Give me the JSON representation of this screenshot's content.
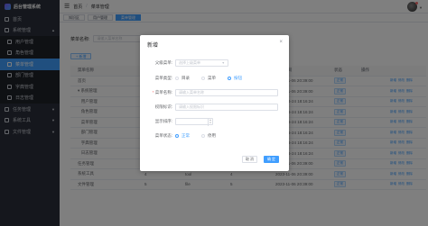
{
  "app": {
    "brand": "后台管理系统"
  },
  "sidebar": {
    "items": [
      {
        "label": "首页",
        "active": false,
        "sub": false,
        "caret": ""
      },
      {
        "label": "系统管理",
        "active": false,
        "sub": false,
        "caret": "▲"
      },
      {
        "label": "用户管理",
        "active": false,
        "sub": true,
        "caret": ""
      },
      {
        "label": "角色管理",
        "active": false,
        "sub": true,
        "caret": ""
      },
      {
        "label": "菜单管理",
        "active": true,
        "sub": true,
        "caret": ""
      },
      {
        "label": "部门管理",
        "active": false,
        "sub": true,
        "caret": ""
      },
      {
        "label": "字典管理",
        "active": false,
        "sub": true,
        "caret": ""
      },
      {
        "label": "日志管理",
        "active": false,
        "sub": true,
        "caret": ""
      },
      {
        "label": "任务管理",
        "active": false,
        "sub": false,
        "caret": "▼"
      },
      {
        "label": "系统工具",
        "active": false,
        "sub": false,
        "caret": "▼"
      },
      {
        "label": "文件管理",
        "active": false,
        "sub": false,
        "caret": "▼"
      }
    ]
  },
  "header": {
    "crumb1": "首页",
    "crumb2": "菜单管理",
    "sep": "/"
  },
  "tags": [
    {
      "label": "知识区",
      "active": false
    },
    {
      "label": "用户管理",
      "active": false
    },
    {
      "label": "菜单管理",
      "active": true
    }
  ],
  "search": {
    "label": "菜单名称:",
    "placeholder": "请输入菜单名称"
  },
  "toolbar": {
    "add_label": "+ 新增"
  },
  "table": {
    "headers": [
      "菜单名称",
      "图标",
      "权限标识",
      "排序",
      "创建时间",
      "状态",
      "操作",
      ""
    ],
    "rows": [
      [
        "首页",
        "",
        "",
        "1",
        "2023-11-06 20:39:00",
        "正常"
      ],
      [
        "系统管理",
        "",
        "",
        "2",
        "2023-11-06 20:39:00",
        "正常"
      ],
      [
        "用户管理",
        "",
        "",
        "",
        "2023-06-24 18:16:24",
        "正常"
      ],
      [
        "角色管理",
        "",
        "",
        "",
        "2023-06-24 18:16:24",
        "正常"
      ],
      [
        "菜单管理",
        "",
        "",
        "",
        "2023-06-24 18:16:24",
        "正常"
      ],
      [
        "部门管理",
        "",
        "",
        "",
        "2023-06-24 18:16:24",
        "正常"
      ],
      [
        "字典管理",
        "",
        "",
        "",
        "2023-06-24 18:16:24",
        "正常"
      ],
      [
        "日志管理",
        "",
        "",
        "",
        "2023-06-24 18:16:24",
        "正常"
      ],
      [
        "任务管理",
        "3",
        "job",
        "3",
        "2023-11-06 20:39:00",
        "正常"
      ],
      [
        "系统工具",
        "4",
        "tool",
        "4",
        "2023-11-06 20:39:00",
        "正常"
      ],
      [
        "文件管理",
        "5",
        "file",
        "5",
        "2023-11-06 20:39:00",
        "正常"
      ]
    ],
    "actions": [
      "新增",
      "修改",
      "删除"
    ]
  },
  "dialog": {
    "title": "新增",
    "close": "×",
    "parent_label": "父级菜单:",
    "parent_placeholder": "选择上级菜单",
    "type_label": "菜单类型:",
    "type_options": [
      {
        "label": "目录",
        "checked": false
      },
      {
        "label": "菜单",
        "checked": false
      },
      {
        "label": "按钮",
        "checked": true
      }
    ],
    "name_label": "菜单名称:",
    "name_req": "*",
    "name_placeholder": "请输入菜单名称",
    "perm_label": "权限标识:",
    "perm_placeholder": "请输入权限标识",
    "order_label": "显示排序:",
    "status_label": "菜单状态:",
    "status_options": [
      {
        "label": "正常",
        "checked": true
      },
      {
        "label": "停用",
        "checked": false
      }
    ],
    "cancel_label": "取 消",
    "ok_label": "确 定"
  },
  "colors": {
    "primary": "#409eff",
    "sidebar_bg": "#2b2f3a",
    "danger": "#f56c6c"
  }
}
